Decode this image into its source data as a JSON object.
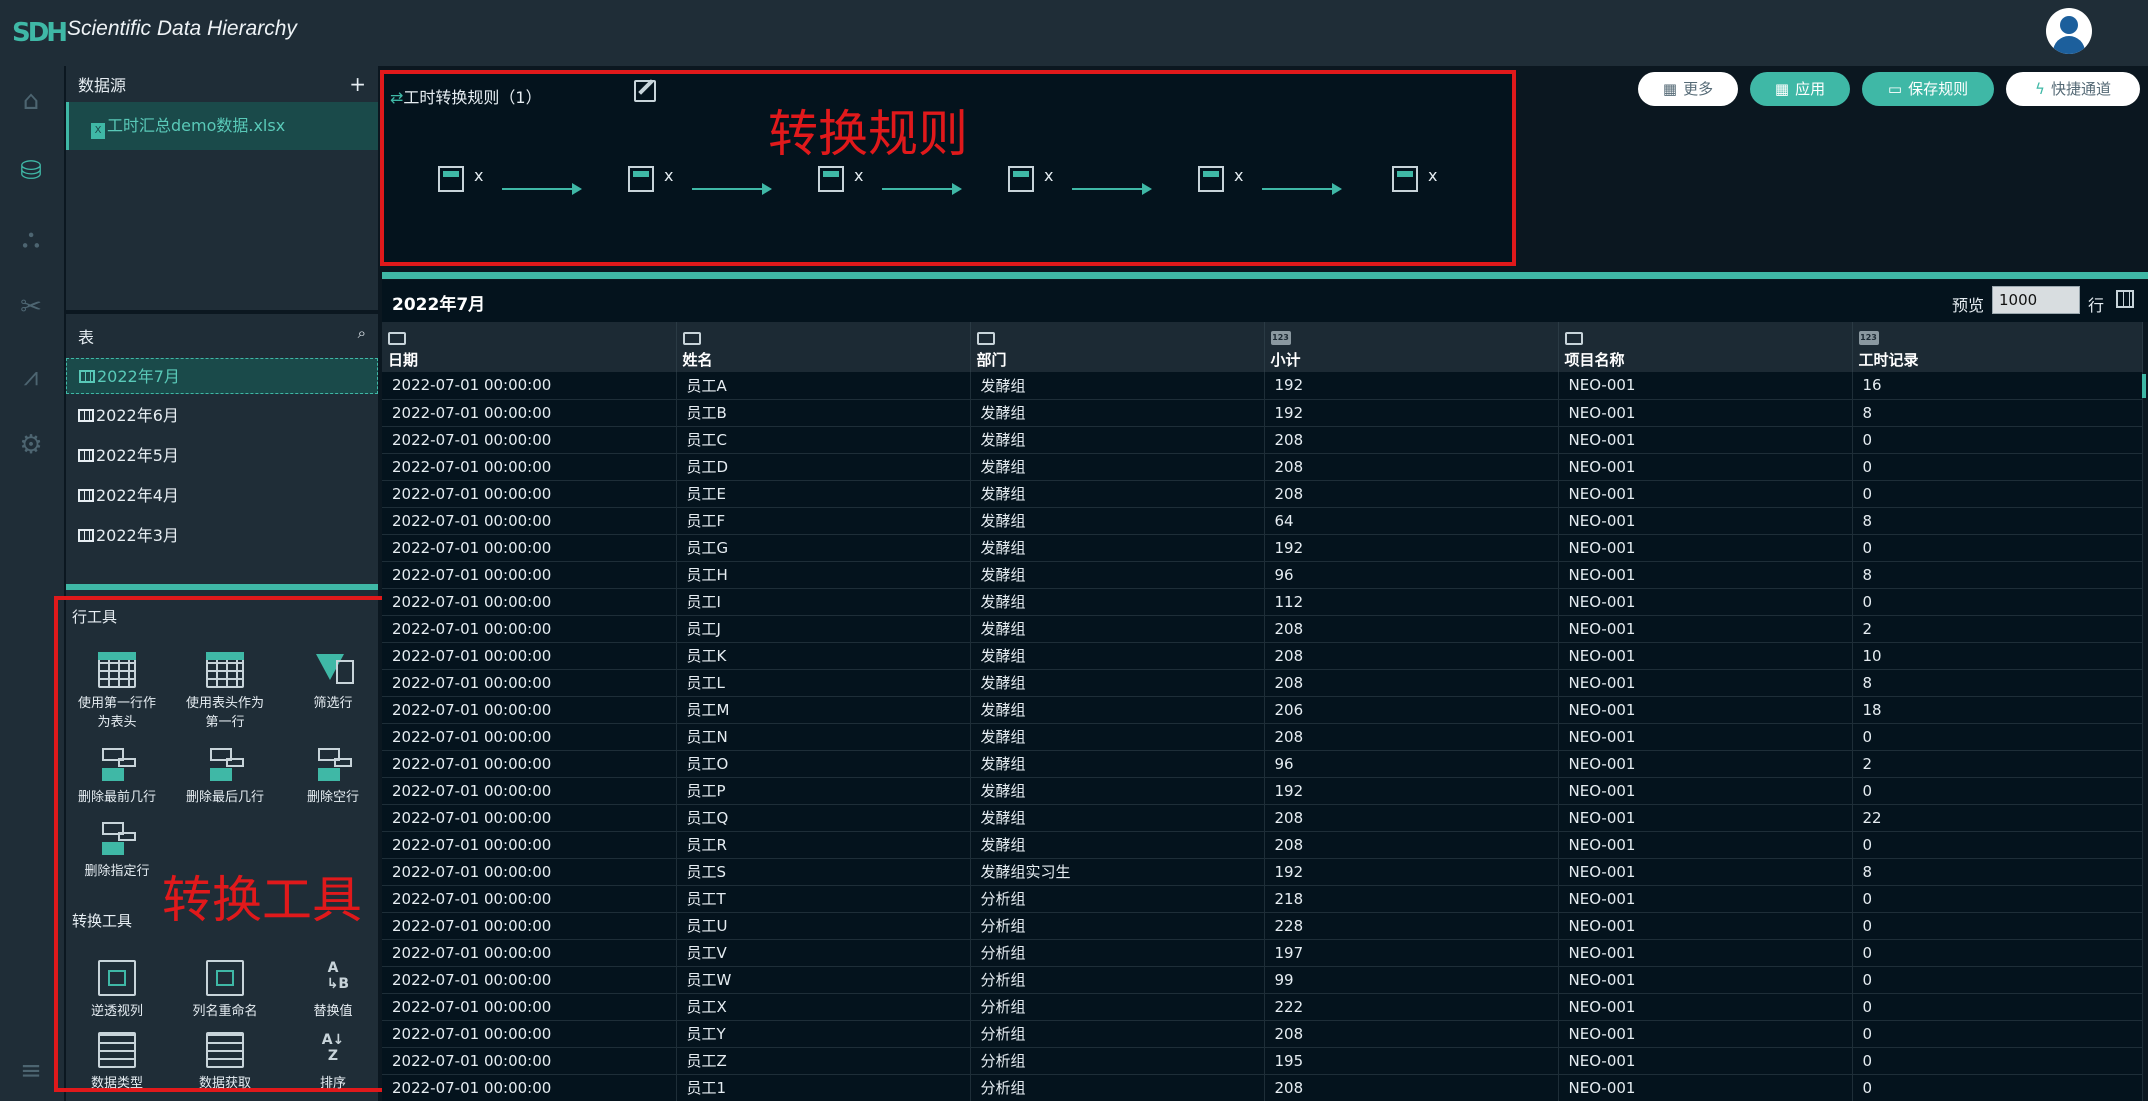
{
  "app": {
    "title": "Scientific Data Hierarchy",
    "logo_text": "SDH"
  },
  "datasource": {
    "title": "数据源",
    "add_label": "+",
    "file": "工时汇总demo数据.xlsx"
  },
  "tables": {
    "title": "表",
    "sheets": [
      "2022年7月",
      "2022年6月",
      "2022年5月",
      "2022年4月",
      "2022年3月"
    ]
  },
  "tools": {
    "row_section": "行工具",
    "row_tools": [
      {
        "label": "使用第一行作为表头",
        "line1": "使用第一行作",
        "line2": "为表头"
      },
      {
        "label": "使用表头作为第一行",
        "line1": "使用表头作为",
        "line2": "第一行"
      },
      {
        "label": "筛选行"
      },
      {
        "label": "删除最前几行"
      },
      {
        "label": "删除最后几行"
      },
      {
        "label": "删除空行"
      },
      {
        "label": "删除指定行"
      }
    ],
    "convert_section": "转换工具",
    "convert_tools": [
      {
        "label": "逆透视列"
      },
      {
        "label": "列名重命名"
      },
      {
        "label": "替换值"
      },
      {
        "label": "数据类型"
      },
      {
        "label": "数据获取"
      },
      {
        "label": "排序"
      }
    ],
    "overlay_label": "转换工具"
  },
  "rules": {
    "title": "工时转换规则（1）",
    "overlay_label": "转换规则",
    "step_remove": "x"
  },
  "toolbar": {
    "more": "更多",
    "apply": "应用",
    "save": "保存规则",
    "quick": "快捷通道"
  },
  "grid": {
    "name": "2022年7月",
    "preview_label": "预览",
    "preview_value": "1000",
    "preview_unit": "行",
    "columns": [
      {
        "name": "日期",
        "type": "date-icon"
      },
      {
        "name": "姓名",
        "type": "text-icon"
      },
      {
        "name": "部门",
        "type": "text-icon"
      },
      {
        "name": "小计",
        "type": "number-icon"
      },
      {
        "name": "项目名称",
        "type": "text-icon"
      },
      {
        "name": "工时记录",
        "type": "number-icon"
      }
    ],
    "number_badge": "123",
    "rows": [
      [
        "2022-07-01 00:00:00",
        "员工A",
        "发酵组",
        "192",
        "NEO-001",
        "16"
      ],
      [
        "2022-07-01 00:00:00",
        "员工B",
        "发酵组",
        "192",
        "NEO-001",
        "8"
      ],
      [
        "2022-07-01 00:00:00",
        "员工C",
        "发酵组",
        "208",
        "NEO-001",
        "0"
      ],
      [
        "2022-07-01 00:00:00",
        "员工D",
        "发酵组",
        "208",
        "NEO-001",
        "0"
      ],
      [
        "2022-07-01 00:00:00",
        "员工E",
        "发酵组",
        "208",
        "NEO-001",
        "0"
      ],
      [
        "2022-07-01 00:00:00",
        "员工F",
        "发酵组",
        "64",
        "NEO-001",
        "8"
      ],
      [
        "2022-07-01 00:00:00",
        "员工G",
        "发酵组",
        "192",
        "NEO-001",
        "0"
      ],
      [
        "2022-07-01 00:00:00",
        "员工H",
        "发酵组",
        "96",
        "NEO-001",
        "8"
      ],
      [
        "2022-07-01 00:00:00",
        "员工I",
        "发酵组",
        "112",
        "NEO-001",
        "0"
      ],
      [
        "2022-07-01 00:00:00",
        "员工J",
        "发酵组",
        "208",
        "NEO-001",
        "2"
      ],
      [
        "2022-07-01 00:00:00",
        "员工K",
        "发酵组",
        "208",
        "NEO-001",
        "10"
      ],
      [
        "2022-07-01 00:00:00",
        "员工L",
        "发酵组",
        "208",
        "NEO-001",
        "8"
      ],
      [
        "2022-07-01 00:00:00",
        "员工M",
        "发酵组",
        "206",
        "NEO-001",
        "18"
      ],
      [
        "2022-07-01 00:00:00",
        "员工N",
        "发酵组",
        "208",
        "NEO-001",
        "0"
      ],
      [
        "2022-07-01 00:00:00",
        "员工O",
        "发酵组",
        "96",
        "NEO-001",
        "2"
      ],
      [
        "2022-07-01 00:00:00",
        "员工P",
        "发酵组",
        "192",
        "NEO-001",
        "0"
      ],
      [
        "2022-07-01 00:00:00",
        "员工Q",
        "发酵组",
        "208",
        "NEO-001",
        "22"
      ],
      [
        "2022-07-01 00:00:00",
        "员工R",
        "发酵组",
        "208",
        "NEO-001",
        "0"
      ],
      [
        "2022-07-01 00:00:00",
        "员工S",
        "发酵组实习生",
        "192",
        "NEO-001",
        "8"
      ],
      [
        "2022-07-01 00:00:00",
        "员工T",
        "分析组",
        "218",
        "NEO-001",
        "0"
      ],
      [
        "2022-07-01 00:00:00",
        "员工U",
        "分析组",
        "228",
        "NEO-001",
        "0"
      ],
      [
        "2022-07-01 00:00:00",
        "员工V",
        "分析组",
        "197",
        "NEO-001",
        "0"
      ],
      [
        "2022-07-01 00:00:00",
        "员工W",
        "分析组",
        "99",
        "NEO-001",
        "0"
      ],
      [
        "2022-07-01 00:00:00",
        "员工X",
        "分析组",
        "222",
        "NEO-001",
        "0"
      ],
      [
        "2022-07-01 00:00:00",
        "员工Y",
        "分析组",
        "208",
        "NEO-001",
        "0"
      ],
      [
        "2022-07-01 00:00:00",
        "员工Z",
        "分析组",
        "195",
        "NEO-001",
        "0"
      ],
      [
        "2022-07-01 00:00:00",
        "员工1",
        "分析组",
        "208",
        "NEO-001",
        "0"
      ]
    ]
  },
  "colors": {
    "accent": "#3fb8a6",
    "highlight_border": "#e0191b",
    "panel": "#1f2d37",
    "surface": "#04131d"
  }
}
